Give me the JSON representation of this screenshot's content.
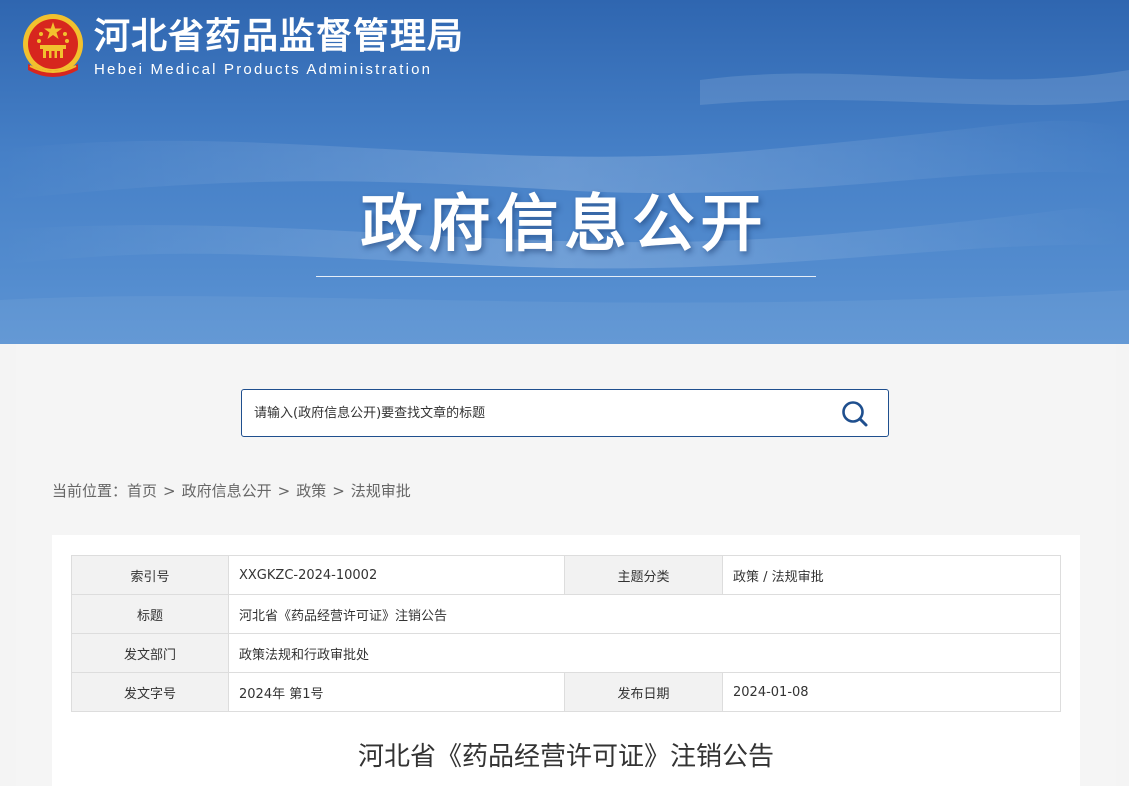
{
  "header": {
    "org_name_cn": "河北省药品监督管理局",
    "org_name_en": "Hebei Medical Products Administration",
    "banner_title": "政府信息公开"
  },
  "search": {
    "placeholder": "请输入(政府信息公开)要查找文章的标题",
    "button_icon": "search-icon"
  },
  "breadcrumb": {
    "prefix": "当前位置：",
    "items": [
      "首页",
      "政府信息公开",
      "政策",
      "法规审批"
    ],
    "separator": ">"
  },
  "metadata": {
    "index_no_label": "索引号",
    "index_no": "XXGKZC-2024-10002",
    "category_label": "主题分类",
    "category": "政策 / 法规审批",
    "title_label": "标题",
    "title": "河北省《药品经营许可证》注销公告",
    "department_label": "发文部门",
    "department": "政策法规和行政审批处",
    "doc_no_label": "发文字号",
    "doc_no": "2024年 第1号",
    "date_label": "发布日期",
    "date": "2024-01-08"
  },
  "article": {
    "heading": "河北省《药品经营许可证》注销公告"
  },
  "colors": {
    "banner_blue": "#2f66b0",
    "search_border": "#1f4f8e",
    "emblem_red": "#d7261e",
    "emblem_gold": "#f2c12e"
  }
}
